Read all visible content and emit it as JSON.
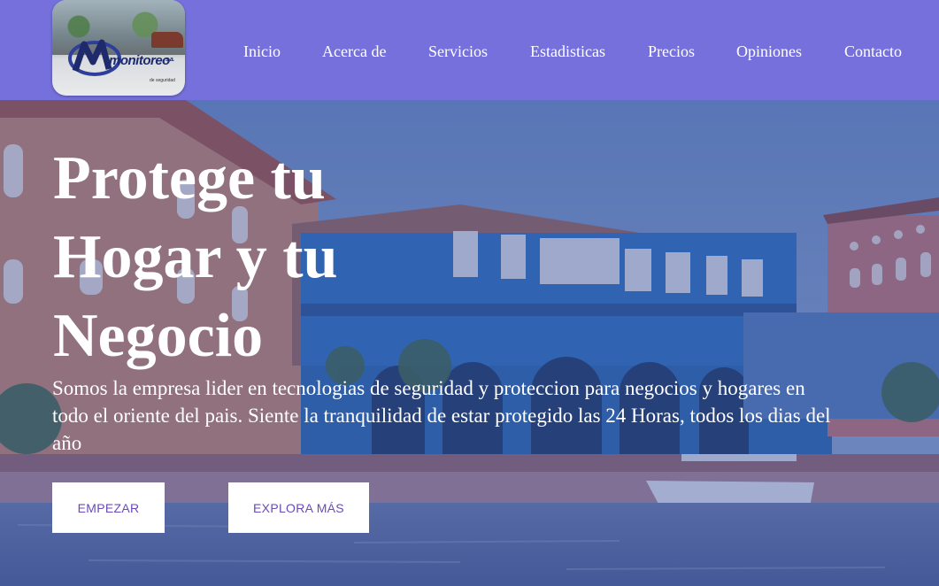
{
  "header": {
    "logo": {
      "name": "monitoreo",
      "suffix": "s.a.",
      "tagline": "de seguridad"
    },
    "nav": [
      {
        "label": "Inicio"
      },
      {
        "label": "Acerca de"
      },
      {
        "label": "Servicios"
      },
      {
        "label": "Estadisticas"
      },
      {
        "label": "Precios"
      },
      {
        "label": "Opiniones"
      },
      {
        "label": "Contacto"
      }
    ]
  },
  "hero": {
    "headline": "Protege tu Hogar y tu Negocio",
    "lead": "Somos la empresa lider en tecnologias de seguridad y proteccion para negocios y hogares en todo el oriente del pais. Siente la tranquilidad de estar protegido las 24 Horas, todos los dias del año",
    "buttons": {
      "primary": "EMPEZAR",
      "secondary": "EXPLORA MÁS"
    }
  },
  "colors": {
    "header_bg": "#7570dc",
    "button_text": "#6a4bb8",
    "overlay": "#3448a0"
  }
}
